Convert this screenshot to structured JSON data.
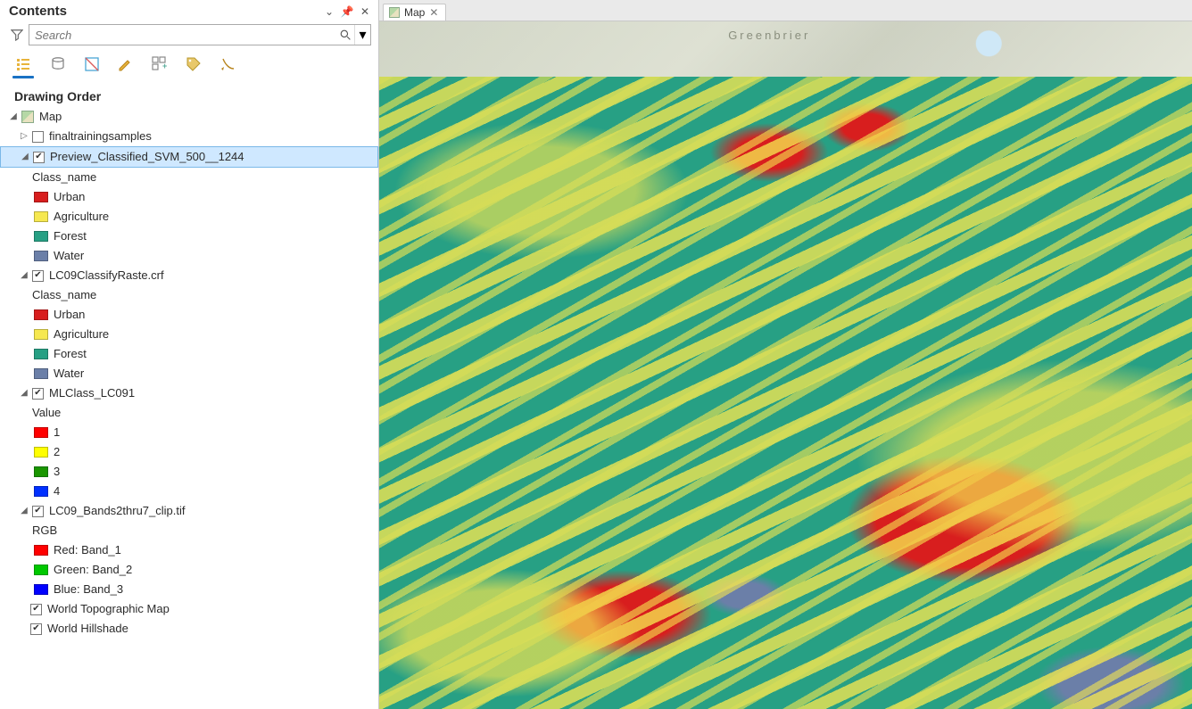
{
  "panel": {
    "title": "Contents",
    "search_placeholder": "Search",
    "section": "Drawing Order"
  },
  "tree": {
    "root": "Map",
    "layers": [
      {
        "name": "finaltrainingsamples",
        "checked": false,
        "expanded": false
      },
      {
        "name": "Preview_Classified_SVM_500__1244",
        "checked": true,
        "expanded": true,
        "selected": true,
        "legend_title": "Class_name",
        "legend": [
          {
            "label": "Urban",
            "color": "#d81e1e"
          },
          {
            "label": "Agriculture",
            "color": "#f6e850"
          },
          {
            "label": "Forest",
            "color": "#27a084"
          },
          {
            "label": "Water",
            "color": "#6b7fa8"
          }
        ]
      },
      {
        "name": "LC09ClassifyRaste.crf",
        "checked": true,
        "expanded": true,
        "legend_title": "Class_name",
        "legend": [
          {
            "label": "Urban",
            "color": "#d81e1e"
          },
          {
            "label": "Agriculture",
            "color": "#f6e850"
          },
          {
            "label": "Forest",
            "color": "#27a084"
          },
          {
            "label": "Water",
            "color": "#6b7fa8"
          }
        ]
      },
      {
        "name": "MLClass_LC091",
        "checked": true,
        "expanded": true,
        "legend_title": "Value",
        "legend": [
          {
            "label": "1",
            "color": "#ff0000"
          },
          {
            "label": "2",
            "color": "#ffff00"
          },
          {
            "label": "3",
            "color": "#1a9600"
          },
          {
            "label": "4",
            "color": "#0030ff"
          }
        ]
      },
      {
        "name": "LC09_Bands2thru7_clip.tif",
        "checked": true,
        "expanded": true,
        "legend_title": "RGB",
        "legend": [
          {
            "label": "Red:   Band_1",
            "color": "#ff0000"
          },
          {
            "label": "Green: Band_2",
            "color": "#00c800"
          },
          {
            "label": "Blue:  Band_3",
            "color": "#0000ff"
          }
        ]
      },
      {
        "name": "World Topographic Map",
        "checked": true,
        "expanded": false,
        "no_legend": true
      },
      {
        "name": "World Hillshade",
        "checked": true,
        "expanded": false,
        "no_legend": true
      }
    ]
  },
  "map_tab": {
    "label": "Map"
  },
  "basemap": {
    "place_label": "Greenbrier"
  }
}
